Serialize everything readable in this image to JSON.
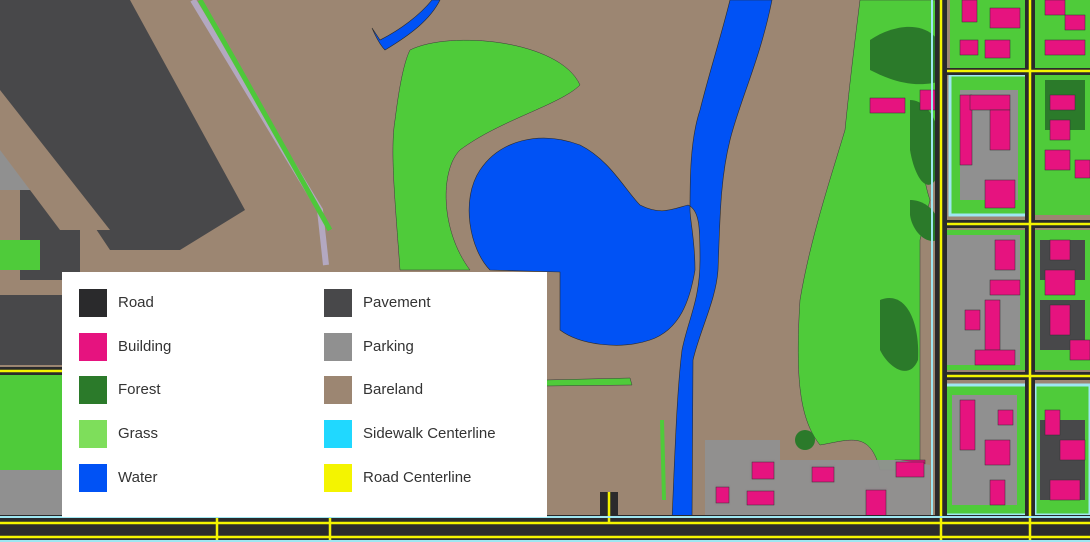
{
  "legend": {
    "items": [
      {
        "label": "Road",
        "color": "#2a2a2c"
      },
      {
        "label": "Building",
        "color": "#e6137f"
      },
      {
        "label": "Forest",
        "color": "#2b7a2a"
      },
      {
        "label": "Grass",
        "color": "#7ede5b"
      },
      {
        "label": "Water",
        "color": "#0052f5"
      },
      {
        "label": "Pavement",
        "color": "#48484a"
      },
      {
        "label": "Parking",
        "color": "#909090"
      },
      {
        "label": "Bareland",
        "color": "#9c8672"
      },
      {
        "label": "Sidewalk Centerline",
        "color": "#20d8ff"
      },
      {
        "label": "Road Centerline",
        "color": "#f4f400"
      }
    ]
  }
}
